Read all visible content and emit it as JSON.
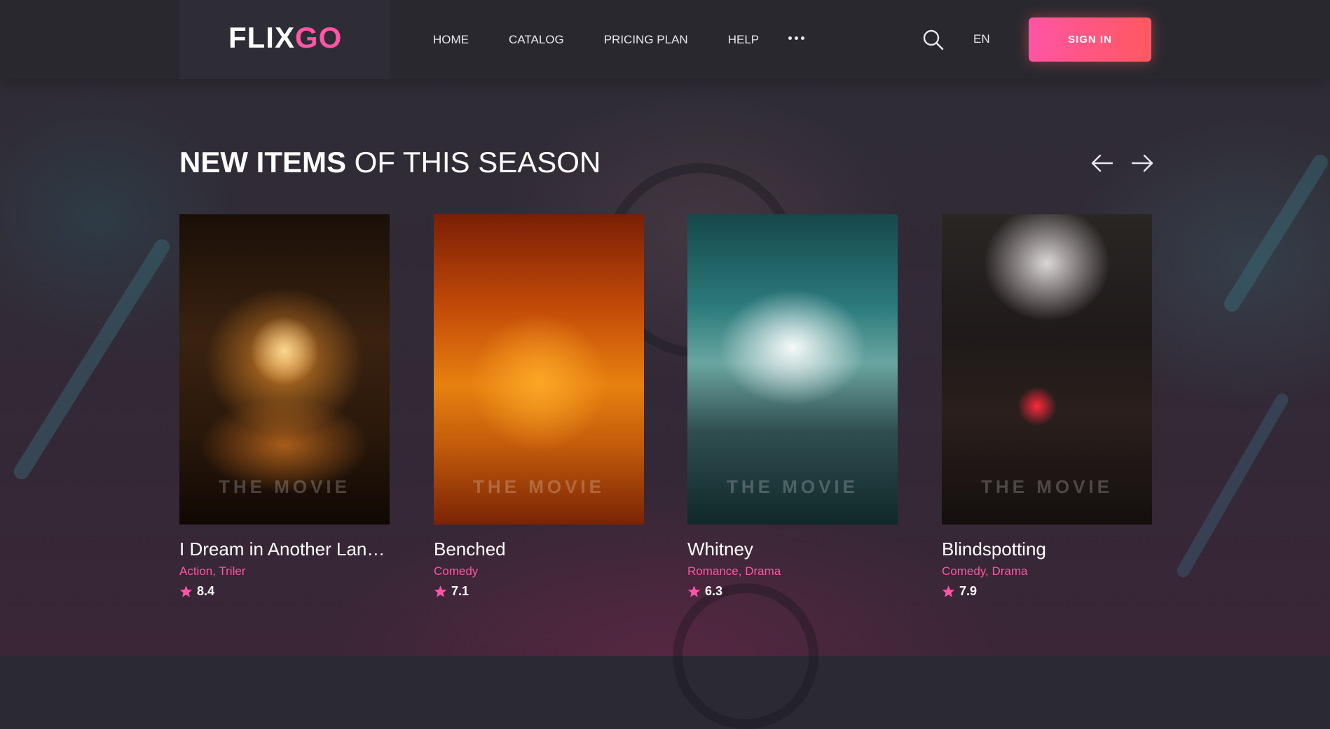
{
  "brand": {
    "logo_part1": "FLIX",
    "logo_part2": "GO",
    "accent_color": "#ff55a5",
    "button_gradient": [
      "#ff55a5",
      "#ff5860"
    ]
  },
  "nav": {
    "items": [
      {
        "label": "HOME"
      },
      {
        "label": "CATALOG"
      },
      {
        "label": "PRICING PLAN"
      },
      {
        "label": "HELP"
      }
    ],
    "more_icon": "more-dots-icon"
  },
  "header": {
    "search_icon": "search-icon",
    "language": "EN",
    "signin_label": "SIGN IN"
  },
  "section": {
    "title_strong": "NEW ITEMS",
    "title_light": "OF THIS SEASON",
    "prev_icon": "arrow-left-icon",
    "next_icon": "arrow-right-icon"
  },
  "movies": [
    {
      "title": "I Dream in Another Language",
      "genres": "Action, Triler",
      "rating": "8.4",
      "cover_text": "THE MOVIE"
    },
    {
      "title": "Benched",
      "genres": "Comedy",
      "rating": "7.1",
      "cover_text": "THE MOVIE"
    },
    {
      "title": "Whitney",
      "genres": "Romance, Drama",
      "rating": "6.3",
      "cover_text": "THE MOVIE"
    },
    {
      "title": "Blindspotting",
      "genres": "Comedy, Drama",
      "rating": "7.9",
      "cover_text": "THE MOVIE"
    }
  ]
}
